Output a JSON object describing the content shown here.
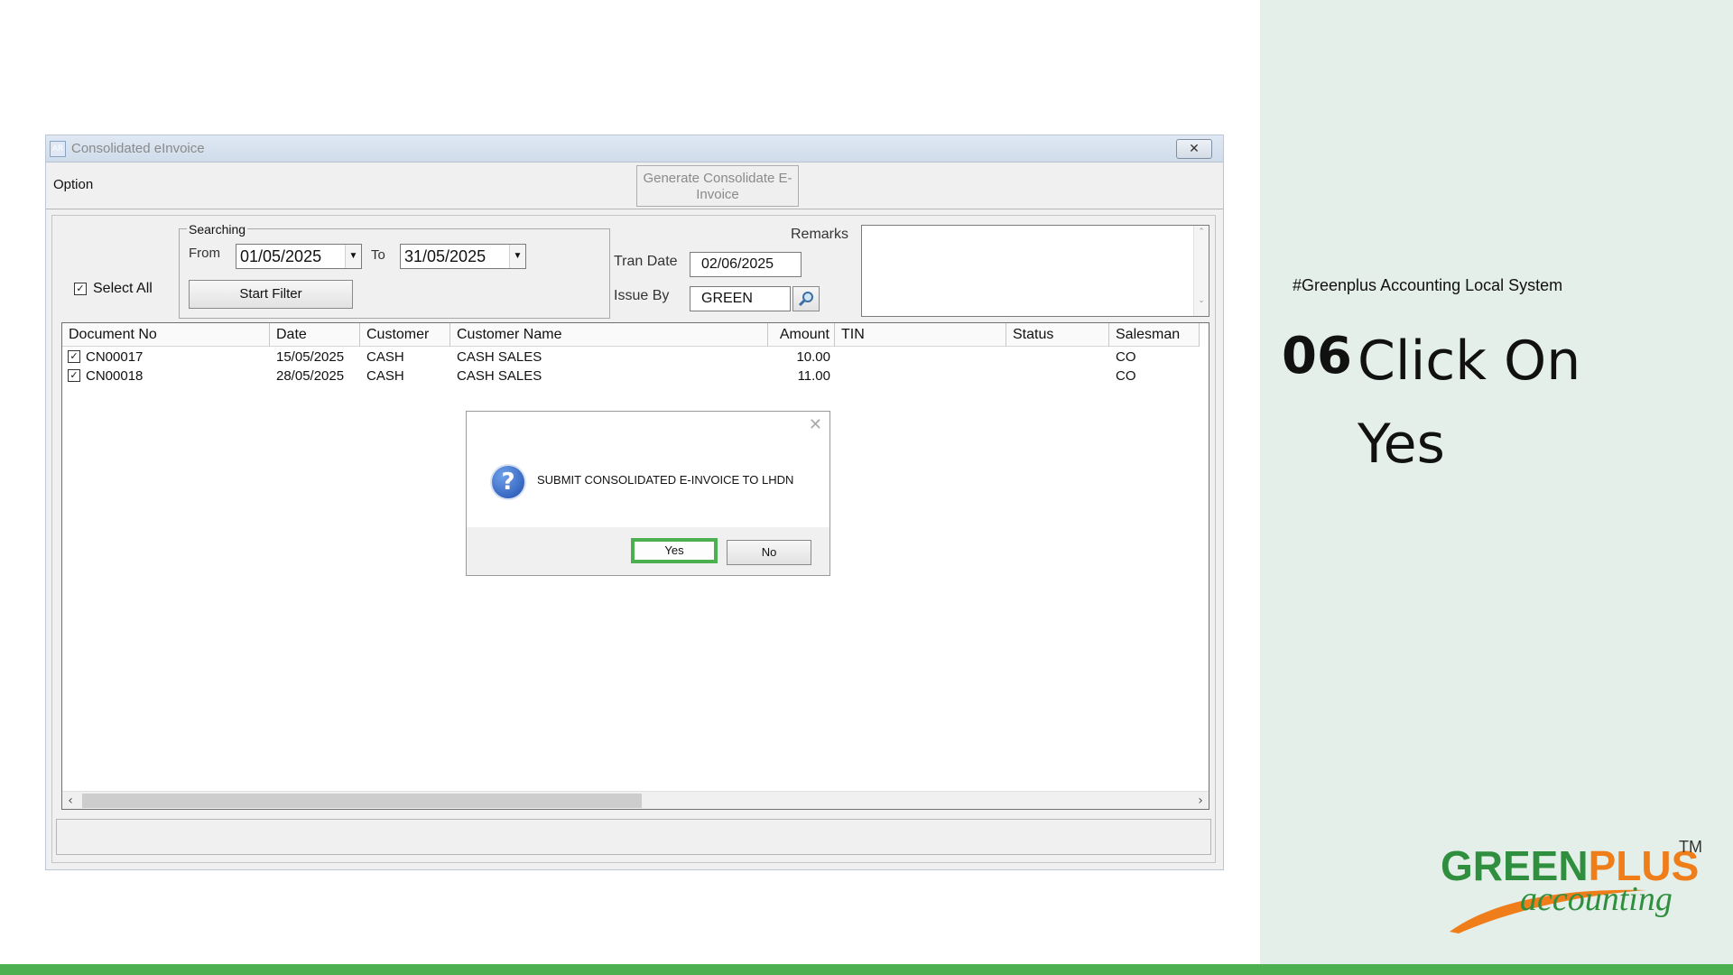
{
  "slide": {
    "tagline": "#Greenplus Accounting Local System",
    "step_number": "06",
    "step_text": "Click On Yes",
    "logo": {
      "main_green": "GREEN",
      "main_orange": "PLUS",
      "tm": "TM",
      "sub": "accounting"
    },
    "colors": {
      "side_bg": "#e4efea",
      "accent_green": "#4caf50",
      "logo_green": "#2f8f3f",
      "logo_orange": "#ee7d1a"
    }
  },
  "window": {
    "title": "Consolidated eInvoice",
    "app_icon": "AR",
    "close_icon": "close-icon",
    "option_label": "Option",
    "generate_button": "Generate Consolidate E-Invoice"
  },
  "filters": {
    "select_all_label": "Select All",
    "select_all_checked": true,
    "searching_label": "Searching",
    "from_label": "From",
    "from_value": "01/05/2025",
    "to_label": "To",
    "to_value": "31/05/2025",
    "start_filter_label": "Start Filter",
    "tran_date_label": "Tran Date",
    "tran_date_value": "02/06/2025",
    "issue_by_label": "Issue By",
    "issue_by_value": "GREEN",
    "remarks_label": "Remarks",
    "remarks_value": ""
  },
  "grid": {
    "columns": [
      "Document No",
      "Date",
      "Customer",
      "Customer Name",
      "Amount",
      "TIN",
      "Status",
      "Salesman"
    ],
    "rows": [
      {
        "checked": true,
        "doc_no": "CN00017",
        "date": "15/05/2025",
        "customer": "CASH",
        "customer_name": "CASH SALES",
        "amount": "10.00",
        "tin": "",
        "status": "",
        "salesman": "CO"
      },
      {
        "checked": true,
        "doc_no": "CN00018",
        "date": "28/05/2025",
        "customer": "CASH",
        "customer_name": "CASH SALES",
        "amount": "11.00",
        "tin": "",
        "status": "",
        "salesman": "CO"
      }
    ]
  },
  "dialog": {
    "icon": "question-icon",
    "message": "SUBMIT CONSOLIDATED E-INVOICE TO LHDN",
    "yes_label": "Yes",
    "no_label": "No"
  }
}
